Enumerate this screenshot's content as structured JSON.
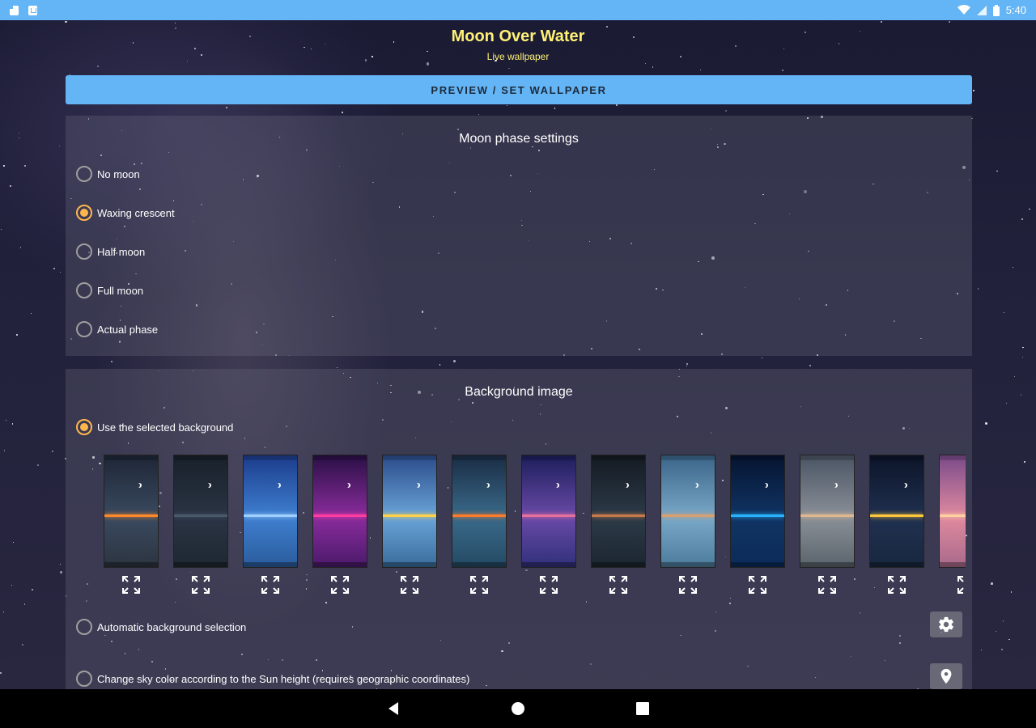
{
  "status_bar": {
    "time": "5:40",
    "left_icons": [
      "sd-card-icon",
      "download-icon"
    ],
    "right_icons": [
      "wifi-icon",
      "signal-icon",
      "battery-icon"
    ]
  },
  "header": {
    "title": "Moon Over Water",
    "subtitle": "Live wallpaper"
  },
  "preview_button": {
    "label": "PREVIEW / SET WALLPAPER"
  },
  "moon_phase": {
    "title": "Moon phase settings",
    "options": [
      {
        "label": "No moon",
        "checked": false
      },
      {
        "label": "Waxing crescent",
        "checked": true
      },
      {
        "label": "Half moon",
        "checked": false
      },
      {
        "label": "Full moon",
        "checked": false
      },
      {
        "label": "Actual phase",
        "checked": false
      }
    ]
  },
  "background": {
    "title": "Background image",
    "use_selected_label": "Use the selected background",
    "use_selected_checked": true,
    "auto_selection_label": "Automatic background selection",
    "auto_selection_checked": false,
    "sky_color_label": "Change sky color according to the Sun height (requires geographic coordinates)",
    "sky_color_checked": false,
    "thumbnails": [
      {
        "sky": "#3a4a60",
        "sky_top": "#1e2636",
        "horizon": "#ff8a2a",
        "water": "#2c3440"
      },
      {
        "sky": "#2a3444",
        "sky_top": "#18202a",
        "horizon": "#4a5a6a",
        "water": "#1e2832"
      },
      {
        "sky": "#3f7fd0",
        "sky_top": "#1c3c8c",
        "horizon": "#9fd0ff",
        "water": "#2a5c9c"
      },
      {
        "sky": "#8a2c9c",
        "sky_top": "#2a1046",
        "horizon": "#ff3ca0",
        "water": "#4a1a6a"
      },
      {
        "sky": "#6aa4d8",
        "sky_top": "#2a4c8a",
        "horizon": "#ffd24a",
        "water": "#3a6c9c"
      },
      {
        "sky": "#3a6a8a",
        "sky_top": "#1a2c44",
        "horizon": "#ff7a2a",
        "water": "#244a64"
      },
      {
        "sky": "#6a4aa8",
        "sky_top": "#1c1e5a",
        "horizon": "#e8709c",
        "water": "#30307a"
      },
      {
        "sky": "#2c3a48",
        "sky_top": "#141a22",
        "horizon": "#c87a4a",
        "water": "#1c2630"
      },
      {
        "sky": "#7aa8c8",
        "sky_top": "#3a6488",
        "horizon": "#d8a070",
        "water": "#4c7c9c"
      },
      {
        "sky": "#103464",
        "sky_top": "#061430",
        "horizon": "#2ab4ff",
        "water": "#0c2c5a"
      },
      {
        "sky": "#8a9098",
        "sky_top": "#4a5464",
        "horizon": "#e0b890",
        "water": "#5a646c"
      },
      {
        "sky": "#203050",
        "sky_top": "#0c1428",
        "horizon": "#ffc83a",
        "water": "#182840"
      },
      {
        "sky": "#e08aa0",
        "sky_top": "#7a4a8a",
        "horizon": "#ffd0a0",
        "water": "#a86a8a"
      }
    ]
  },
  "nav_bar": {
    "buttons": [
      "back-icon",
      "home-icon",
      "recents-icon"
    ]
  }
}
